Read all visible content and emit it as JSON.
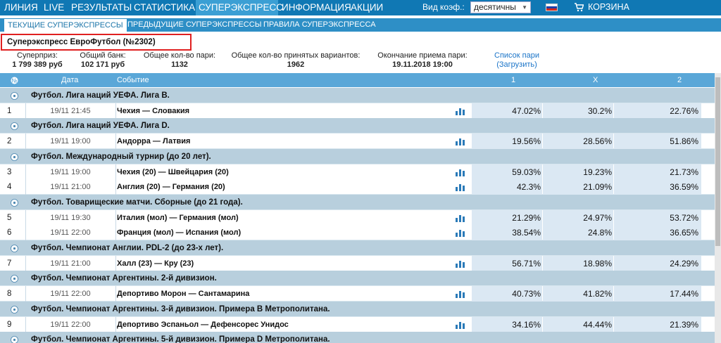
{
  "nav": {
    "items": [
      "ЛИНИЯ",
      "LIVE",
      "РЕЗУЛЬТАТЫ",
      "СТАТИСТИКА",
      "СУПЕРЭКСПРЕСС",
      "ИНФОРМАЦИЯ",
      "АКЦИИ"
    ],
    "active_index": 4,
    "coef_label": "Вид коэф.:",
    "coef_value": "десятичны",
    "cart_label": "КОРЗИНА"
  },
  "subnav": {
    "items": [
      "ТЕКУЩИЕ СУПЕРЭКСПРЕССЫ",
      "ПРЕДЫДУЩИЕ СУПЕРЭКСПРЕССЫ",
      "ПРАВИЛА СУПЕРЭКСПРЕССА"
    ]
  },
  "title": "Суперэкспресс ЕвроФутбол (№2302)",
  "stats": {
    "prize_label": "Суперприз:",
    "prize_value": "1 799 389 руб",
    "bank_label": "Общий банк:",
    "bank_value": "102 171 руб",
    "bets_label": "Общее кол-во пари:",
    "bets_value": "1132",
    "variants_label": "Общее кол-во принятых вариантов:",
    "variants_value": "1962",
    "end_label": "Окончание приема пари:",
    "end_value": "19.11.2018 19:00",
    "list_link": "Список пари",
    "load_link": "(Загрузить)"
  },
  "table": {
    "headers": {
      "num": "№",
      "date": "Дата",
      "event": "Событие",
      "c1": "1",
      "cx": "X",
      "c2": "2"
    },
    "leagues": [
      "Футбол. Лига наций УЕФА. Лига B.",
      "Футбол. Лига наций УЕФА. Лига D.",
      "Футбол. Международный турнир (до 20 лет).",
      "Футбол. Товарищеские матчи. Сборные (до 21 года).",
      "Футбол. Чемпионат Англии. PDL-2 (до 23-х лет).",
      "Футбол. Чемпионат Аргентины. 2-й дивизион.",
      "Футбол. Чемпионат Аргентины. 3-й дивизион. Примера В Метрополитана.",
      "Футбол. Чемпионат Аргентины. 5-й дивизион. Примера D Метрополитана."
    ],
    "matches": [
      {
        "num": "1",
        "date": "19/11 21:45",
        "event": "Чехия — Словакия",
        "p1": "47.02%",
        "px": "30.2%",
        "p2": "22.76%"
      },
      {
        "num": "2",
        "date": "19/11 19:00",
        "event": "Андорра — Латвия",
        "p1": "19.56%",
        "px": "28.56%",
        "p2": "51.86%"
      },
      {
        "num": "3",
        "date": "19/11 19:00",
        "event": "Чехия (20) — Швейцария (20)",
        "p1": "59.03%",
        "px": "19.23%",
        "p2": "21.73%"
      },
      {
        "num": "4",
        "date": "19/11 21:00",
        "event": "Англия (20) — Германия (20)",
        "p1": "42.3%",
        "px": "21.09%",
        "p2": "36.59%"
      },
      {
        "num": "5",
        "date": "19/11 19:30",
        "event": "Италия (мол) — Германия (мол)",
        "p1": "21.29%",
        "px": "24.97%",
        "p2": "53.72%"
      },
      {
        "num": "6",
        "date": "19/11 22:00",
        "event": "Франция (мол) — Испания (мол)",
        "p1": "38.54%",
        "px": "24.8%",
        "p2": "36.65%"
      },
      {
        "num": "7",
        "date": "19/11 21:00",
        "event": "Халл (23) — Кру (23)",
        "p1": "56.71%",
        "px": "18.98%",
        "p2": "24.29%"
      },
      {
        "num": "8",
        "date": "19/11 22:00",
        "event": "Депортиво Морон — Сантамарина",
        "p1": "40.73%",
        "px": "41.82%",
        "p2": "17.44%"
      },
      {
        "num": "9",
        "date": "19/11 22:00",
        "event": "Депортиво Эспаньол — Дефенсорес Унидос",
        "p1": "34.16%",
        "px": "44.44%",
        "p2": "21.39%"
      }
    ]
  },
  "colors": {
    "nav_bg": "#1078b4",
    "nav_active": "#3b9fd4",
    "subnav_bg": "#2e8fc6",
    "header_bg": "#5aa7d8",
    "league_bg": "#b8cfdd",
    "pct_bg": "#dbe8f3",
    "highlight": "#e02020"
  }
}
